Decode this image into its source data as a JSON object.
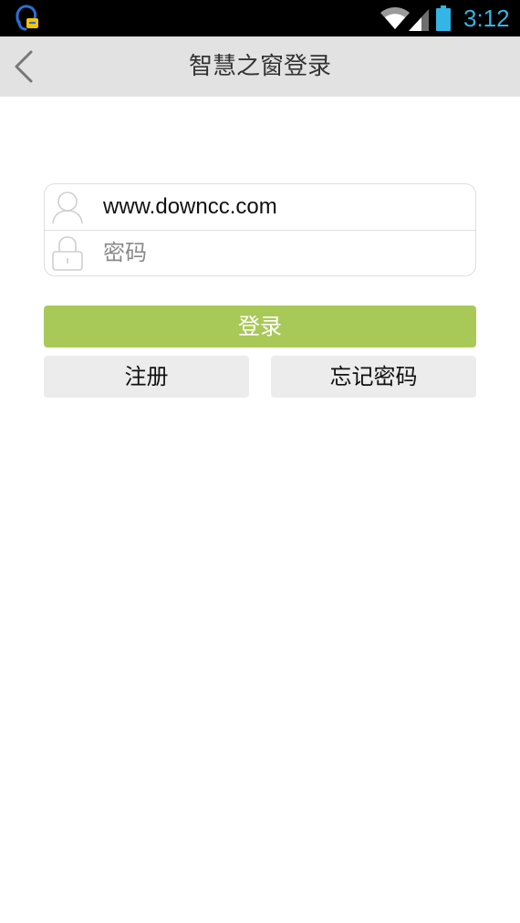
{
  "status_bar": {
    "time": "3:12",
    "time_color": "#33b5e5",
    "icons": [
      "notification-app-icon",
      "wifi-icon",
      "signal-icon",
      "battery-icon"
    ]
  },
  "title_bar": {
    "title": "智慧之窗登录",
    "back_icon": "chevron-left-icon",
    "background": "#e2e2e2"
  },
  "login_form": {
    "username_value": "www.downcc.com",
    "username_icon": "user-icon",
    "password_placeholder": "密码",
    "password_icon": "lock-icon"
  },
  "buttons": {
    "login_label": "登录",
    "login_color": "#a8c957",
    "register_label": "注册",
    "forgot_label": "忘记密码"
  }
}
